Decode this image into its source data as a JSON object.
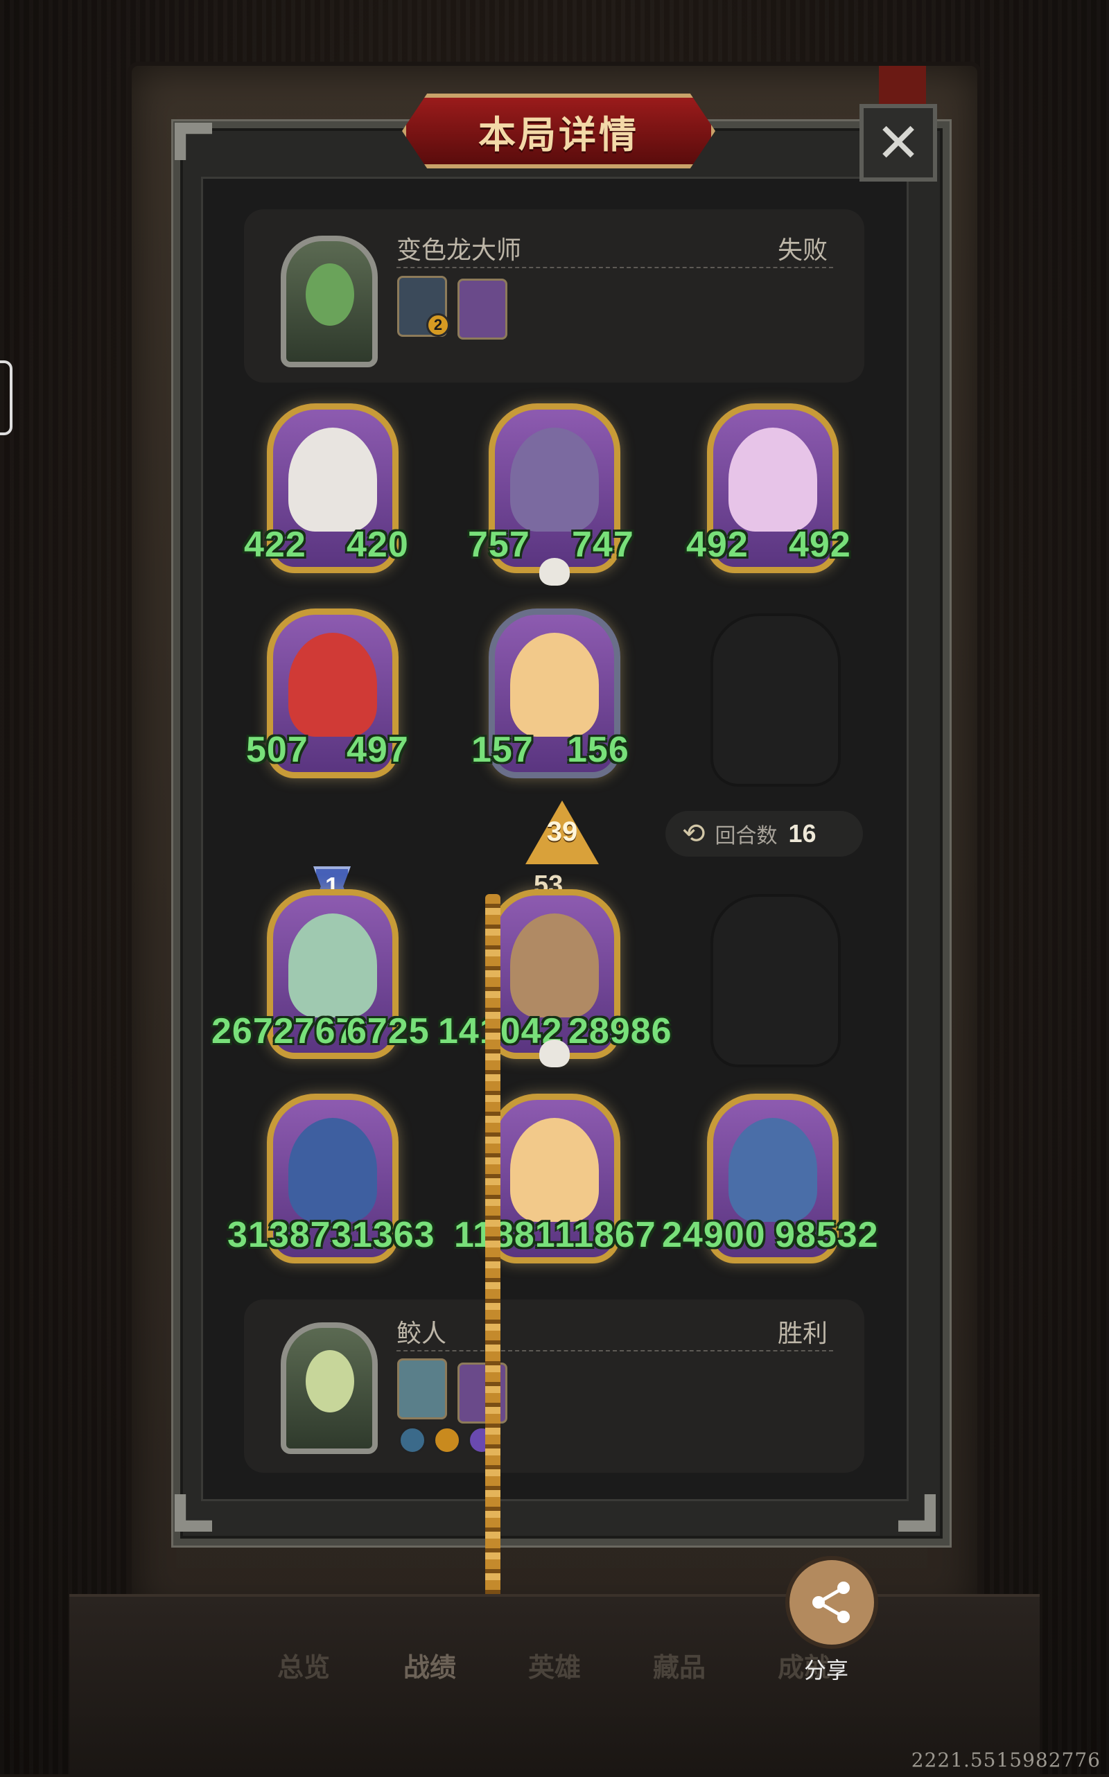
{
  "title": "本局详情",
  "close_icon": "close-icon",
  "top_player": {
    "name": "变色龙大师",
    "result": "失败",
    "badge_count": "2",
    "board": [
      {
        "left": "422",
        "right": "420"
      },
      {
        "left": "757",
        "right": "747"
      },
      {
        "left": "492",
        "right": "492"
      },
      {
        "left": "507",
        "right": "497"
      },
      {
        "left": "157",
        "right": "156"
      }
    ]
  },
  "rounds": {
    "label": "回合数",
    "value": "16"
  },
  "arrow_value": "39",
  "tier_badge": "1",
  "level_value": "53",
  "bottom_board": [
    {
      "left": "2672767",
      "right": "6725"
    },
    {
      "left": "141042",
      "right": "28986"
    },
    {
      "left": "31387",
      "right": "31363"
    },
    {
      "left": "11881",
      "right": "11867"
    },
    {
      "left": "24900",
      "right": "98532"
    }
  ],
  "bottom_player": {
    "name": "鲛人",
    "result": "胜利"
  },
  "tabs": [
    "总览",
    "战绩",
    "英雄",
    "藏品",
    "成就"
  ],
  "share_label": "分享",
  "coords": "2221.5515982776"
}
